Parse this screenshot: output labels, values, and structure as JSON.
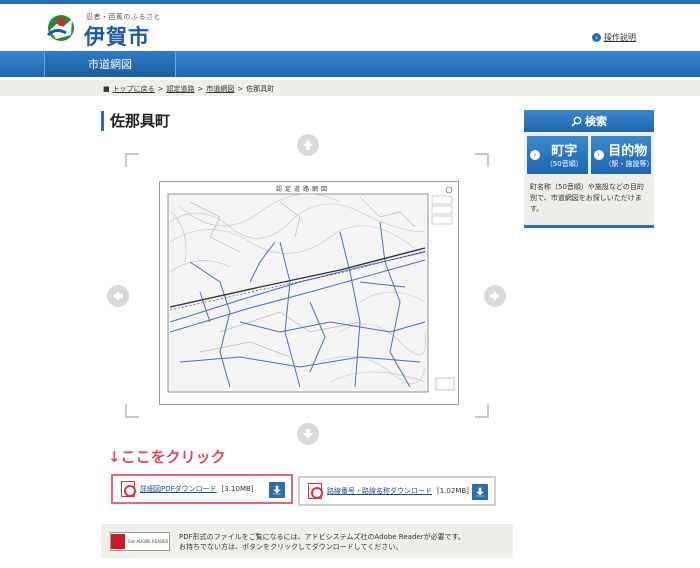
{
  "header": {
    "tagline": "忍者・芭蕉のふるさと",
    "site_name": "伊賀市",
    "help_label": "操作説明"
  },
  "nav": {
    "items": [
      {
        "label": "市道網図"
      }
    ]
  },
  "breadcrumb": {
    "home": "トップに戻る",
    "level1": "認定道路",
    "level2": "市道網図",
    "current": "佐那具町",
    "sep": ">"
  },
  "page": {
    "title": "佐那具町"
  },
  "map": {
    "heading": "認定道路網図"
  },
  "hint": {
    "text": "↓ここをクリック"
  },
  "downloads": [
    {
      "label": "詳細図PDFダウンロード",
      "size": "[3.10MB]"
    },
    {
      "label": "路線番号・路線名称ダウンロード",
      "size": "[1.02MB]"
    }
  ],
  "reader": {
    "badge": "Get ADOBE READER",
    "line1": "PDF形式のファイルをご覧になるには、アドビシステムズ社のAdobe Readerが必要です。",
    "line2": "お持ちでない方は、ボタンをクリックしてダウンロードしてください。"
  },
  "search": {
    "title": "検索",
    "town": {
      "main": "町字",
      "sub": "（50音順）"
    },
    "target": {
      "main": "目的物",
      "sub": "（駅・施設等）"
    },
    "description": "町名称（50音順）や施設などの目的別で、市道網図をお探しいただけます。"
  },
  "colors": {
    "brand": "#2a6db0",
    "hint": "#e04a5b",
    "highlight": "#e06878"
  }
}
